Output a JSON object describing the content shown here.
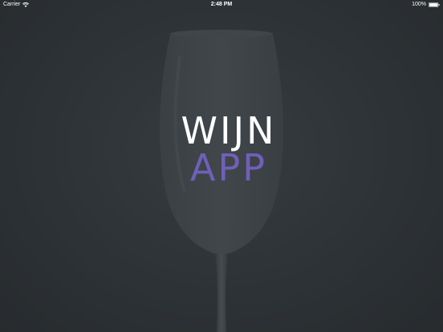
{
  "status_bar": {
    "carrier": "Carrier",
    "time": "2:48 PM",
    "battery_percent": "100%",
    "battery_level": 1.0
  },
  "logo": {
    "line1": "WIJN",
    "line2": "APP",
    "line1_color": "#ffffff",
    "line2_color": "#7060b8"
  },
  "background": {
    "color": "#2b3034",
    "image": "wine-glass-icon"
  }
}
